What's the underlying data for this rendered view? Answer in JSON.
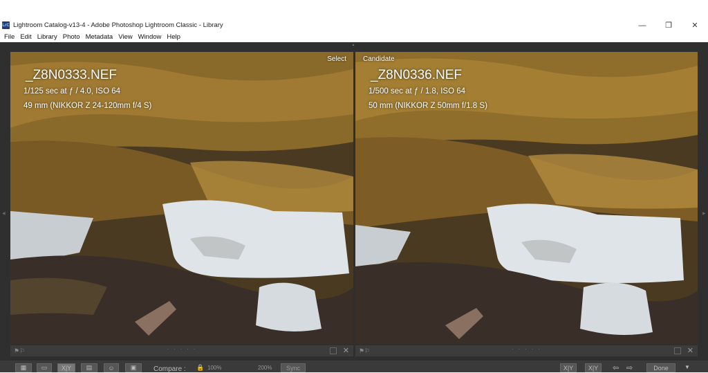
{
  "window": {
    "title": "Lightroom Catalog-v13-4 - Adobe Photoshop Lightroom Classic - Library",
    "logo_text": "LrC"
  },
  "menu": [
    "File",
    "Edit",
    "Library",
    "Photo",
    "Metadata",
    "View",
    "Window",
    "Help"
  ],
  "select_pane": {
    "tag": "Select",
    "filename": "_Z8N0333.NEF",
    "exposure": "1/125 sec at ƒ / 4.0, ISO 64",
    "lens": "49 mm (NIKKOR Z 24-120mm f/4 S)"
  },
  "candidate_pane": {
    "tag": "Candidate",
    "filename": "_Z8N0336.NEF",
    "exposure": "1/500 sec at ƒ / 1.8, ISO 64",
    "lens": "50 mm (NIKKOR Z 50mm f/1.8 S)"
  },
  "toolbar": {
    "compare_label": "Compare :",
    "zoom_min": "100%",
    "zoom_max": "200%",
    "sync_label": "Sync",
    "done_label": "Done",
    "compare_view_label": "X|Y"
  },
  "colors": {
    "workspace": "#2f2f2f",
    "moss": "#8a6a2a",
    "lichen": "#dfe4e8",
    "rock": "#3a2e28"
  }
}
